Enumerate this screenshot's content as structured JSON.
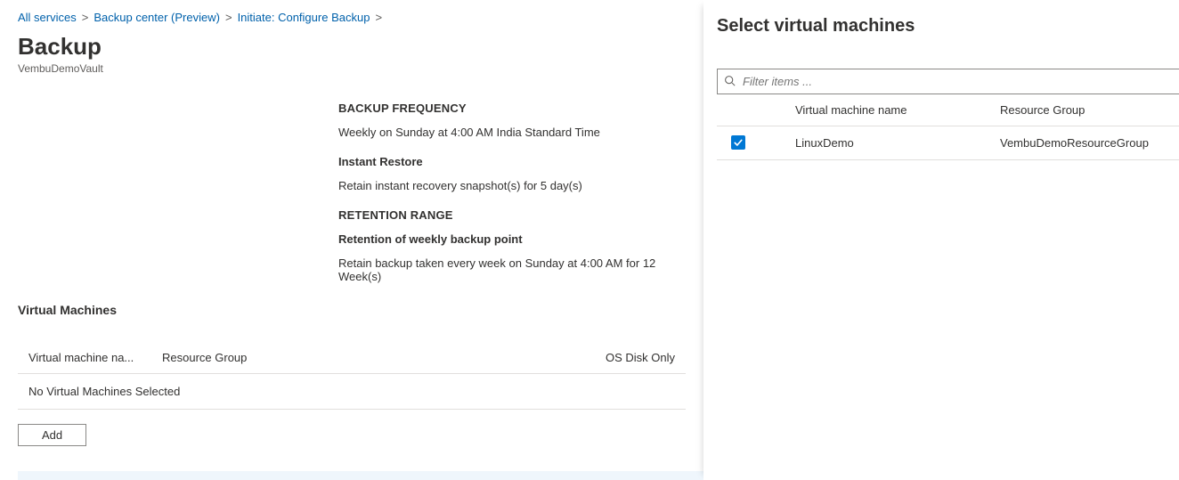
{
  "breadcrumb": {
    "items": [
      {
        "label": "All services"
      },
      {
        "label": "Backup center (Preview)"
      },
      {
        "label": "Initiate: Configure Backup"
      }
    ]
  },
  "header": {
    "title": "Backup",
    "subtitle": "VembuDemoVault"
  },
  "policy": {
    "freq_heading": "BACKUP FREQUENCY",
    "freq_text": "Weekly on Sunday at 4:00 AM India Standard Time",
    "instant_heading": "Instant Restore",
    "instant_text": "Retain instant recovery snapshot(s) for 5 day(s)",
    "retention_heading": "RETENTION RANGE",
    "retention_sub": "Retention of weekly backup point",
    "retention_text": "Retain backup taken every week on Sunday at 4:00 AM for 12 Week(s)"
  },
  "vm_section": {
    "heading": "Virtual Machines",
    "col_name": "Virtual machine na...",
    "col_rg": "Resource Group",
    "col_disk": "OS Disk Only",
    "empty_row": "No Virtual Machines Selected",
    "add_label": "Add"
  },
  "side": {
    "title": "Select virtual machines",
    "filter_placeholder": "Filter items ...",
    "col_name": "Virtual machine name",
    "col_rg": "Resource Group",
    "rows": [
      {
        "checked": true,
        "name": "LinuxDemo",
        "rg": "VembuDemoResourceGroup"
      }
    ]
  }
}
